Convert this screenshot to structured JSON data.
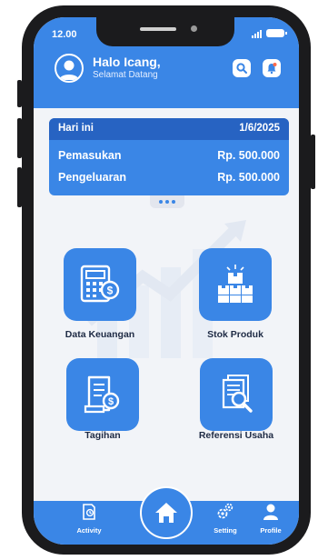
{
  "status_bar": {
    "time": "12.00"
  },
  "header": {
    "greeting": "Halo Icang,",
    "subtitle": "Selamat Datang",
    "icons": [
      "search-icon",
      "bell-icon"
    ]
  },
  "summary": {
    "today_label": "Hari ini",
    "date": "1/6/2025",
    "income_label": "Pemasukan",
    "income_value": "Rp. 500.000",
    "expense_label": "Pengeluaran",
    "expense_value": "Rp. 500.000"
  },
  "menu": {
    "data_keuangan": "Data Keuangan",
    "stok_produk": "Stok Produk",
    "tagihan": "Tagihan",
    "referensi_usaha": "Referensi Usaha"
  },
  "nav": {
    "activity": "Activity",
    "setting": "Setting",
    "profile": "Profile"
  },
  "colors": {
    "primary": "#3a86e6",
    "primary_dark": "#2763c2",
    "background": "#f2f4f8",
    "phone_frame": "#1b1b1d"
  }
}
